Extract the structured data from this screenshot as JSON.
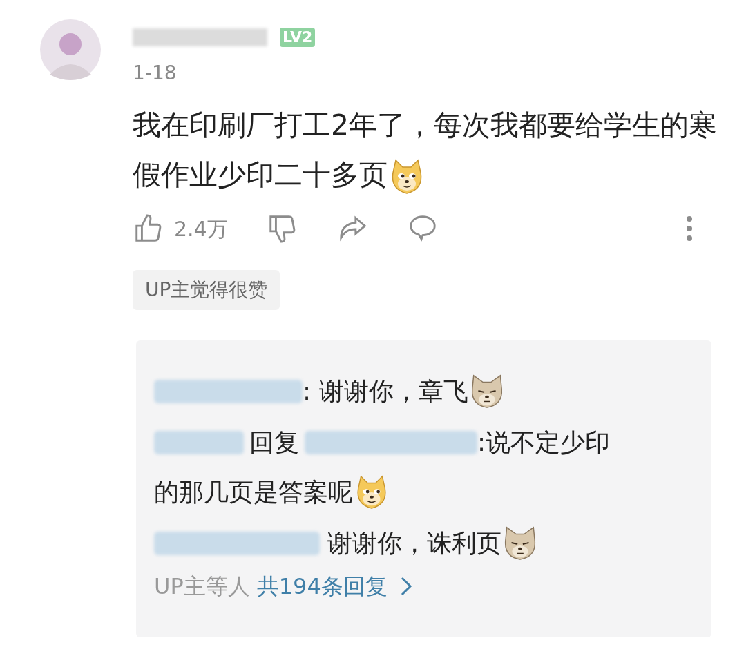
{
  "comment": {
    "level_badge": "LV2",
    "date": "1-18",
    "text": "我在印刷厂打工2年了，每次我都要给学生的寒假作业少印二十多页",
    "text_emoji": {
      "kind": "doge"
    },
    "actions": {
      "like_count": "2.4万"
    },
    "tag": "UP主觉得很赞"
  },
  "replies": [
    {
      "kind": "plain",
      "lines": [
        ": 谢谢你，章飞"
      ],
      "emoji": {
        "kind": "wolf"
      }
    },
    {
      "kind": "reply_to",
      "reply_word": "回复",
      "lines": [
        ":说不定少印",
        "的那几页是答案呢"
      ],
      "emoji": {
        "kind": "doge"
      }
    },
    {
      "kind": "plain",
      "lines": [
        " 谢谢你，诛利页"
      ],
      "emoji": {
        "kind": "wolf"
      }
    }
  ],
  "replies_footer": {
    "prefix": "UP主等人",
    "link": "共194条回复"
  }
}
